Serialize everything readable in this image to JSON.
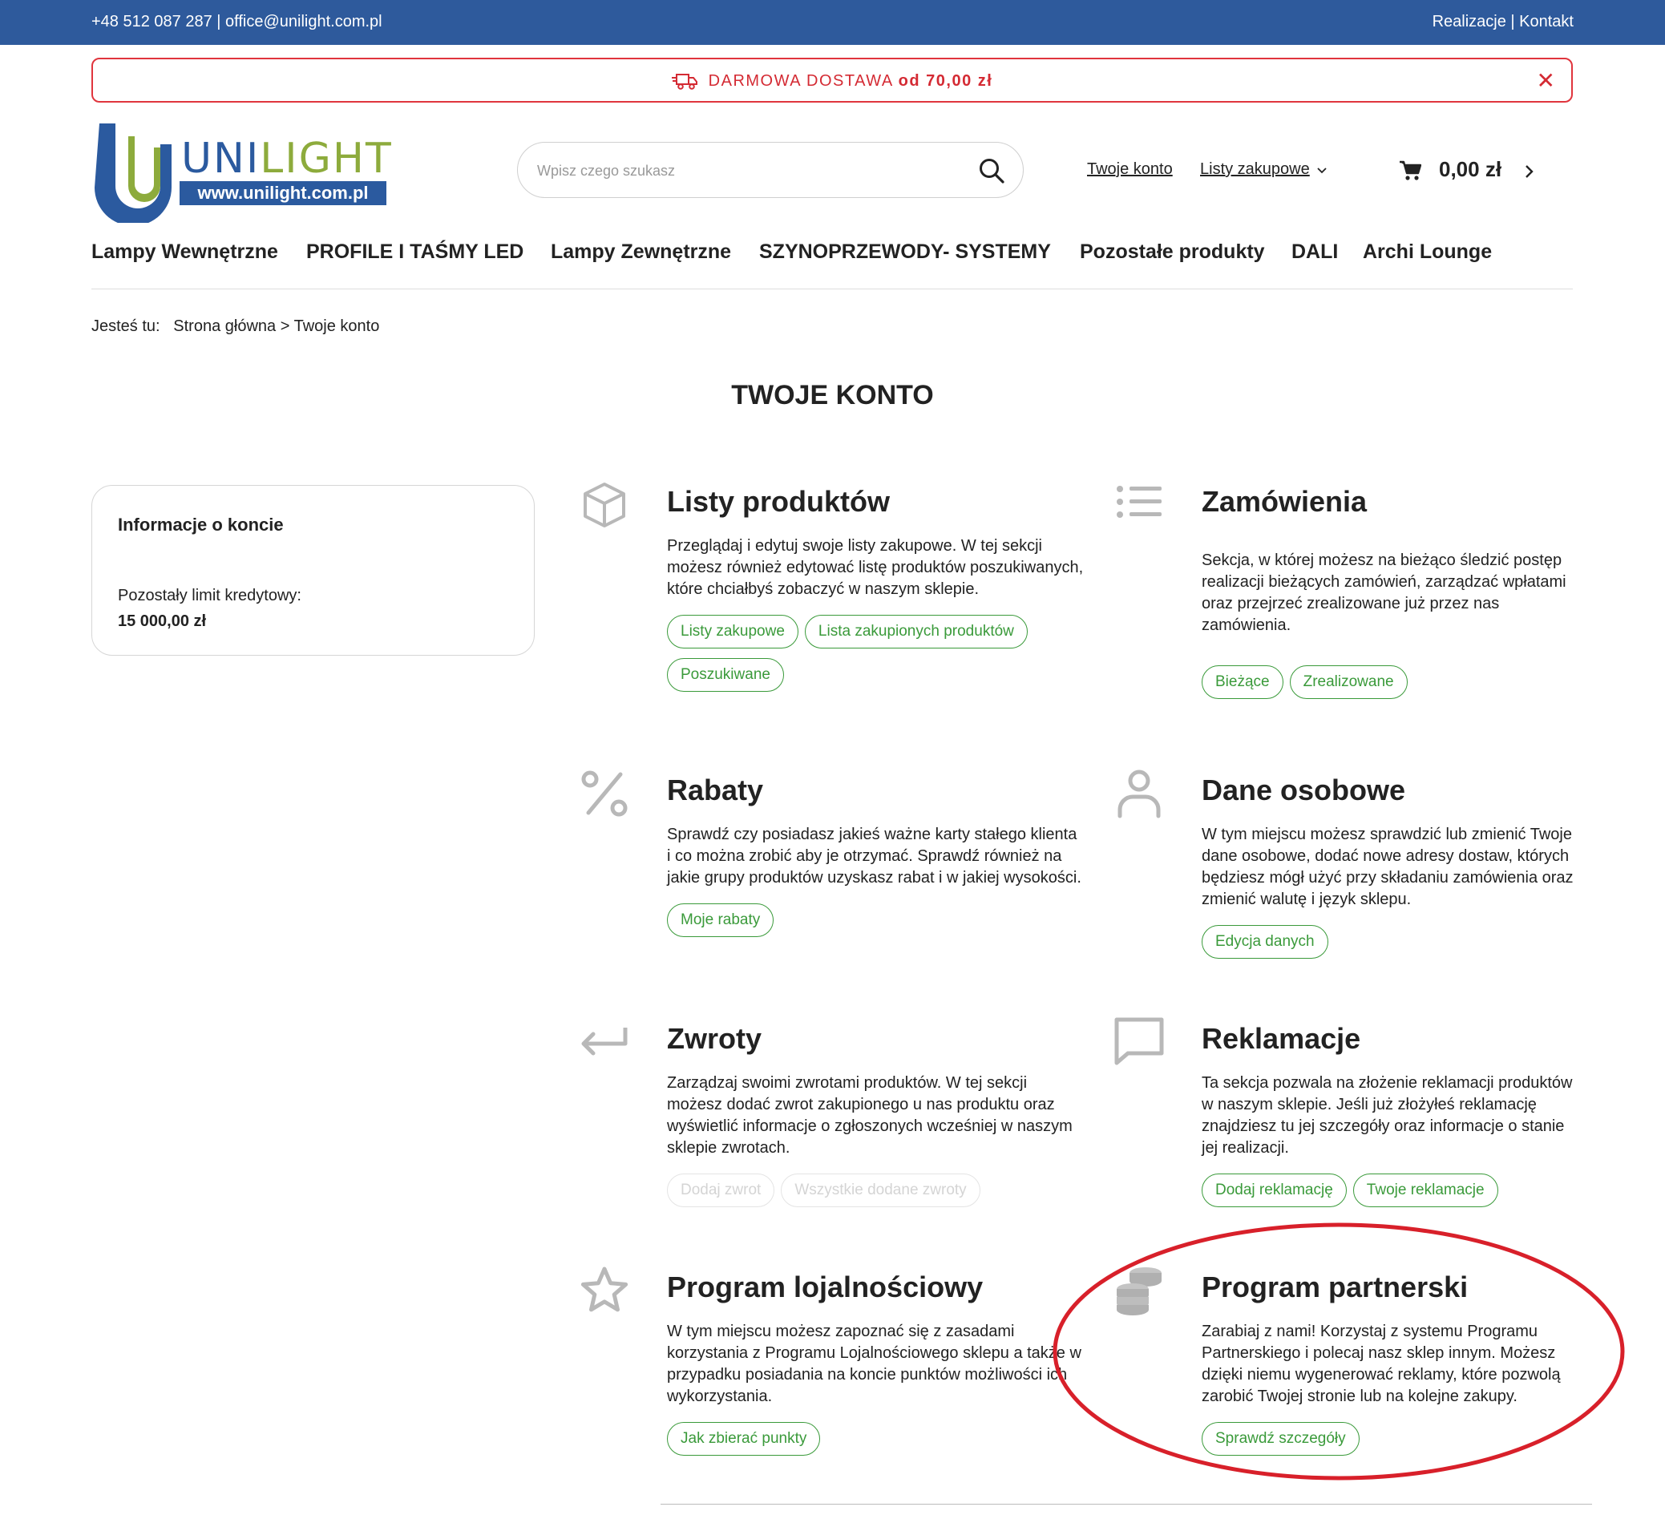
{
  "topbar": {
    "contact": "+48 512 087 287 | office@unilight.com.pl",
    "links": "Realizacje | Kontakt"
  },
  "promo": {
    "text_prefix": "DARMOWA DOSTAWA",
    "text_bold": "od 70,00 zł",
    "close": "✕",
    "color": "#d42a33"
  },
  "logo": {
    "brand_uni": "UNI",
    "brand_light": "LIGHT",
    "url": "www.unilight.com.pl"
  },
  "search": {
    "placeholder": "Wpisz czego szukasz"
  },
  "header": {
    "account": "Twoje konto",
    "lists": "Listy zakupowe",
    "cart_total": "0,00 zł"
  },
  "nav": [
    "Lampy Wewnętrzne",
    "PROFILE I TAŚMY LED",
    "Lampy Zewnętrzne",
    "SZYNOPRZEWODY- SYSTEMY",
    "Pozostałe produkty",
    "DALI",
    "Archi Lounge"
  ],
  "breadcrumb": {
    "label": "Jesteś tu:",
    "home": "Strona główna",
    "sep": ">",
    "current": "Twoje konto"
  },
  "page_title": "TWOJE KONTO",
  "account_info": {
    "title": "Informacje o koncie",
    "credit_label": "Pozostały limit kredytowy:",
    "credit_value": "15 000,00 zł"
  },
  "sections": {
    "lists": {
      "icon": "box-icon",
      "title": "Listy produktów",
      "desc": "Przeglądaj i edytuj swoje listy zakupowe. W tej sekcji możesz również edytować listę produktów poszukiwanych, które chciałbyś zobaczyć w naszym sklepie.",
      "buttons": [
        "Listy zakupowe",
        "Lista zakupionych produktów",
        "Poszukiwane"
      ]
    },
    "orders": {
      "icon": "list-icon",
      "title": "Zamówienia",
      "desc": "Sekcja, w której możesz na bieżąco śledzić postęp realizacji bieżących zamówień, zarządzać wpłatami oraz przejrzeć zrealizowane już przez nas zamówienia.",
      "buttons": [
        "Bieżące",
        "Zrealizowane"
      ]
    },
    "discounts": {
      "icon": "percent-icon",
      "title": "Rabaty",
      "desc": "Sprawdź czy posiadasz jakieś ważne karty stałego klienta i co można zrobić aby je otrzymać. Sprawdź również na jakie grupy produktów uzyskasz rabat i w jakiej wysokości.",
      "buttons": [
        "Moje rabaty"
      ]
    },
    "personal": {
      "icon": "user-icon",
      "title": "Dane osobowe",
      "desc": "W tym miejscu możesz sprawdzić lub zmienić Twoje dane osobowe, dodać nowe adresy dostaw, których będziesz mógł użyć przy składaniu zamówienia oraz zmienić walutę i język sklepu.",
      "buttons": [
        "Edycja danych"
      ]
    },
    "returns": {
      "icon": "return-arrow-icon",
      "title": "Zwroty",
      "desc": "Zarządzaj swoimi zwrotami produktów. W tej sekcji możesz dodać zwrot zakupionego u nas produktu oraz wyświetlić informacje o zgłoszonych wcześniej w naszym sklepie zwrotach.",
      "buttons": [
        "Dodaj zwrot",
        "Wszystkie dodane zwroty"
      ]
    },
    "complaints": {
      "icon": "speech-bubble-icon",
      "title": "Reklamacje",
      "desc": "Ta sekcja pozwala na złożenie reklamacji produktów w naszym sklepie. Jeśli już złożyłeś reklamację znajdziesz tu jej szczegóły oraz informacje o stanie jej realizacji.",
      "buttons": [
        "Dodaj reklamację",
        "Twoje reklamacje"
      ]
    },
    "loyalty": {
      "icon": "star-icon",
      "title": "Program lojalnościowy",
      "desc": "W tym miejscu możesz zapoznać się z zasadami korzystania z Programu Lojalnościowego sklepu a także w przypadku posiadania na koncie punktów możliwości ich wykorzystania.",
      "buttons": [
        "Jak zbierać punkty"
      ]
    },
    "partner": {
      "icon": "coins-icon",
      "title": "Program partnerski",
      "desc": "Zarabiaj z nami! Korzystaj z systemu Programu Partnerskiego i polecaj nasz sklep innym. Możesz dzięki niemu wygenerować reklamy, które pozwolą zarobić Twojej stronie lub na kolejne zakupy.",
      "buttons": [
        "Sprawdź szczegóły"
      ]
    }
  },
  "colors": {
    "topbar": "#2e5a9c",
    "accent_green": "#3a9a3a",
    "annotation_red": "#d8202a"
  }
}
